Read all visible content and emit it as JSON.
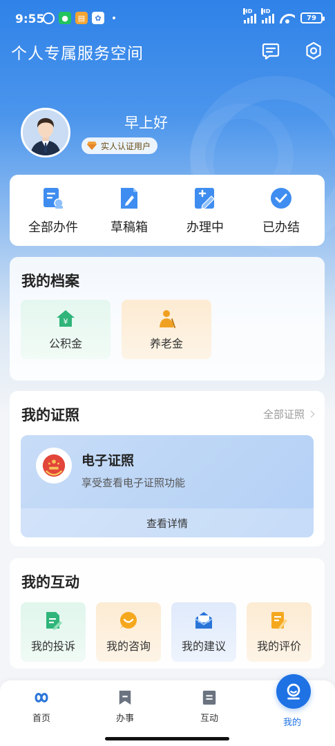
{
  "status_bar": {
    "time": "9:55",
    "battery": "79"
  },
  "header": {
    "title": "个人专属服务空间"
  },
  "profile": {
    "greeting": "早上好",
    "badge": "实人认证用户"
  },
  "affairs": [
    {
      "label": "全部办件",
      "icon": "all-files-icon"
    },
    {
      "label": "草稿箱",
      "icon": "draft-icon"
    },
    {
      "label": "办理中",
      "icon": "processing-icon"
    },
    {
      "label": "已办结",
      "icon": "completed-icon"
    }
  ],
  "archive": {
    "title": "我的档案",
    "items": [
      {
        "label": "公积金",
        "icon": "house-fund-icon"
      },
      {
        "label": "养老金",
        "icon": "pension-icon"
      }
    ]
  },
  "license": {
    "title": "我的证照",
    "all_link": "全部证照",
    "ecert_title": "电子证照",
    "ecert_desc": "享受查看电子证照功能",
    "ecert_action": "查看详情"
  },
  "interact": {
    "title": "我的互动",
    "items": [
      {
        "label": "我的投诉",
        "icon": "complaint-icon"
      },
      {
        "label": "我的咨询",
        "icon": "consult-icon"
      },
      {
        "label": "我的建议",
        "icon": "suggestion-icon"
      },
      {
        "label": "我的评价",
        "icon": "evaluation-icon"
      }
    ]
  },
  "nav": {
    "items": [
      {
        "label": "首页",
        "icon": "home-icon"
      },
      {
        "label": "办事",
        "icon": "bookmark-icon"
      },
      {
        "label": "互动",
        "icon": "document-icon"
      },
      {
        "label": "我的",
        "icon": "user-icon",
        "active": true
      }
    ]
  },
  "colors": {
    "primary": "#1e72e4",
    "header_blue": "#2f82e8"
  }
}
